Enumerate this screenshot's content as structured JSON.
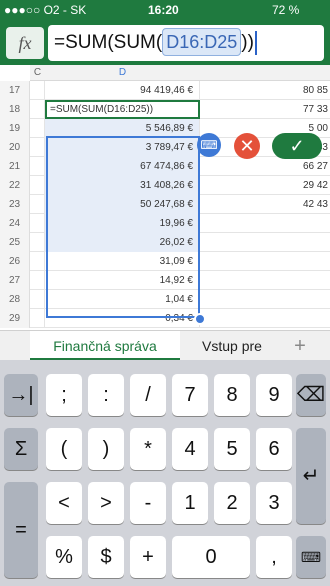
{
  "status": {
    "carrier": "●●●○○ O2 - SK",
    "time": "16:20",
    "battery": "72 %"
  },
  "formula_bar": {
    "fx_label": "fx",
    "prefix": "=SUM(SUM(",
    "reference": "D16:D25",
    "suffix": "))"
  },
  "sheet": {
    "columns": [
      "C",
      "D"
    ],
    "rows": [
      {
        "num": "17",
        "d": "94 419,46 €",
        "e": "80 85"
      },
      {
        "num": "18",
        "d": "=SUM(SUM(D16:D25))",
        "e": "77 33"
      },
      {
        "num": "19",
        "d": "5 546,89 €",
        "e": "5 00"
      },
      {
        "num": "20",
        "d": "3 789,47 €",
        "e": "3 33"
      },
      {
        "num": "21",
        "d": "67 474,86 €",
        "e": "66 27"
      },
      {
        "num": "22",
        "d": "31 408,26 €",
        "e": "29 42"
      },
      {
        "num": "23",
        "d": "50 247,68 €",
        "e": "42 43"
      },
      {
        "num": "24",
        "d": "19,96 €",
        "e": ""
      },
      {
        "num": "25",
        "d": "26,02 €",
        "e": ""
      },
      {
        "num": "26",
        "d": "31,09 €",
        "e": ""
      },
      {
        "num": "27",
        "d": "14,92 €",
        "e": ""
      },
      {
        "num": "28",
        "d": "1,04 €",
        "e": ""
      },
      {
        "num": "29",
        "d": "0,34 €",
        "e": ""
      }
    ]
  },
  "actions": {
    "keyboard_icon": "keyboard-icon",
    "cancel": "✕",
    "confirm": "✓"
  },
  "tabs": {
    "active": "Finančná správa",
    "other": "Vstup pre",
    "add": "+"
  },
  "keyboard": {
    "row1": [
      "→|",
      ";",
      ":",
      "/",
      "7",
      "8",
      "9",
      "⌫"
    ],
    "row2": [
      "Σ",
      "(",
      ")",
      "*",
      "4",
      "5",
      "6",
      "↵"
    ],
    "row3": [
      "=",
      "<",
      ">",
      "-",
      "1",
      "2",
      "3"
    ],
    "row4": [
      "%",
      "$",
      "+",
      "0",
      ","
    ]
  }
}
